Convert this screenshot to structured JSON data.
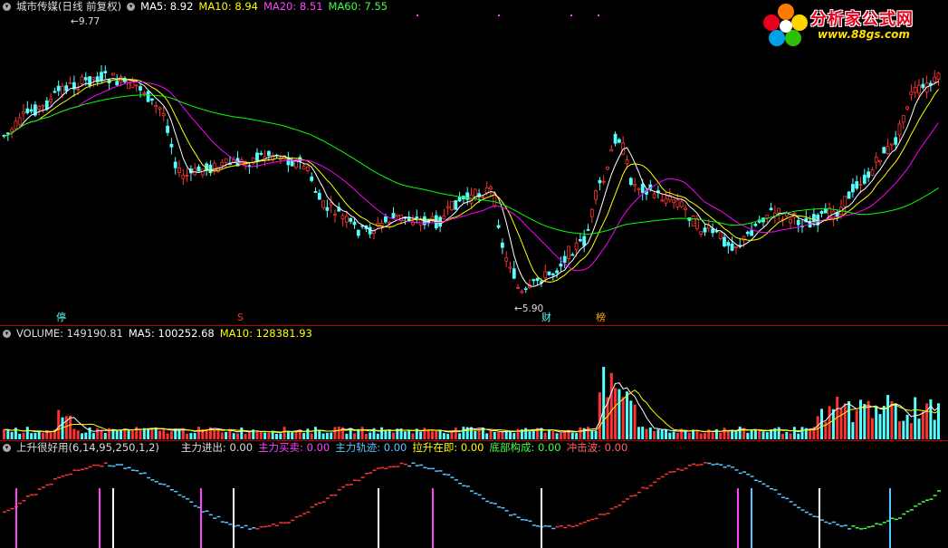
{
  "price": {
    "title": "城市传媒(日线 前复权)",
    "ma5_label": "MA5: 8.92",
    "ma10_label": "MA10: 8.94",
    "ma20_label": "MA20: 8.51",
    "ma60_label": "MA60: 7.55",
    "high_label": "9.77",
    "low_label": "5.90",
    "badges": [
      "停",
      "S",
      "财",
      "榜"
    ]
  },
  "volume": {
    "vol_label": "VOLUME: 149190.81",
    "ma5_label": "MA5: 100252.68",
    "ma10_label": "MA10: 128381.93"
  },
  "indicator": {
    "name": "上升很好用(6,14,95,250,1,2)",
    "items": [
      "主力进出: 0.00",
      "主力买卖: 0.00",
      "主力轨迹: 0.00",
      "拉升在即: 0.00",
      "底部构成: 0.00",
      "冲击波: 0.00"
    ]
  },
  "logo": {
    "title": "分析家公式网",
    "url": "www.88gs.com"
  },
  "colors": {
    "up": "#ff3232",
    "down": "#54ffff",
    "ma5": "#ffffff",
    "ma10": "#ffff00",
    "ma20": "#ff00ff",
    "ma60": "#00ff00",
    "grid": "#b00000"
  }
}
